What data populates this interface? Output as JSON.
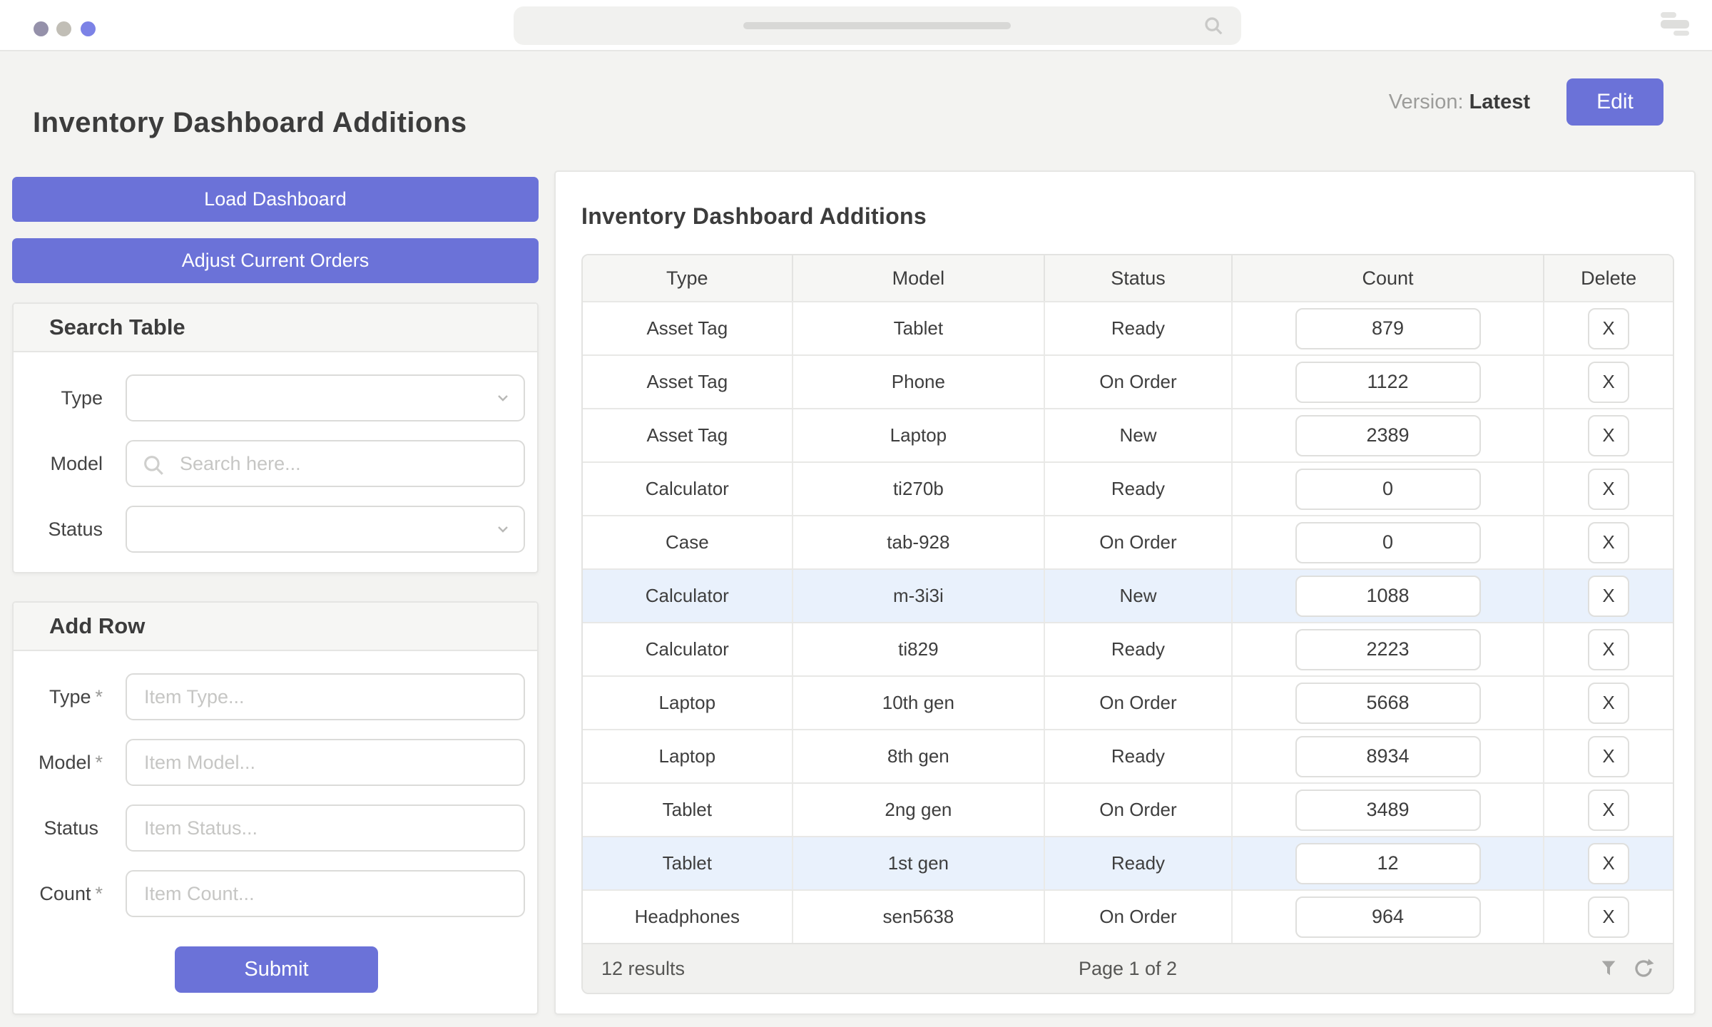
{
  "colors": {
    "accent": "#6b72d8",
    "row_highlight": "#e9f1fc",
    "window_dots": [
      "#9591aa",
      "#c1beb6",
      "#7c82e6"
    ]
  },
  "header": {
    "title": "Inventory Dashboard Additions",
    "version_label": "Version:",
    "version_value": "Latest",
    "edit_button": "Edit"
  },
  "sidebar": {
    "load_dashboard_button": "Load Dashboard",
    "adjust_orders_button": "Adjust Current Orders",
    "search_table": {
      "title": "Search Table",
      "fields": [
        {
          "label": "Type"
        },
        {
          "label": "Model",
          "placeholder": "Search here..."
        },
        {
          "label": "Status"
        }
      ]
    },
    "add_row": {
      "title": "Add Row",
      "fields": [
        {
          "label": "Type",
          "req_mark": "*",
          "placeholder": "Item Type..."
        },
        {
          "label": "Model",
          "req_mark": "*",
          "placeholder": "Item Model..."
        },
        {
          "label": "Status",
          "req_mark": "",
          "placeholder": "Item Status..."
        },
        {
          "label": "Count",
          "req_mark": "*",
          "placeholder": "Item Count..."
        }
      ],
      "submit_button": "Submit"
    }
  },
  "main": {
    "title": "Inventory Dashboard Additions",
    "table": {
      "columns": [
        "Type",
        "Model",
        "Status",
        "Count",
        "Delete"
      ],
      "delete_label": "X",
      "rows": [
        {
          "type": "Asset Tag",
          "model": "Tablet",
          "status": "Ready",
          "count": "879",
          "highlighted": false
        },
        {
          "type": "Asset Tag",
          "model": "Phone",
          "status": "On Order",
          "count": "1122",
          "highlighted": false
        },
        {
          "type": "Asset Tag",
          "model": "Laptop",
          "status": "New",
          "count": "2389",
          "highlighted": false
        },
        {
          "type": "Calculator",
          "model": "ti270b",
          "status": "Ready",
          "count": "0",
          "highlighted": false
        },
        {
          "type": "Case",
          "model": "tab-928",
          "status": "On Order",
          "count": "0",
          "highlighted": false
        },
        {
          "type": "Calculator",
          "model": "m-3i3i",
          "status": "New",
          "count": "1088",
          "highlighted": true
        },
        {
          "type": "Calculator",
          "model": "ti829",
          "status": "Ready",
          "count": "2223",
          "highlighted": false
        },
        {
          "type": "Laptop",
          "model": "10th gen",
          "status": "On Order",
          "count": "5668",
          "highlighted": false
        },
        {
          "type": "Laptop",
          "model": "8th gen",
          "status": "Ready",
          "count": "8934",
          "highlighted": false
        },
        {
          "type": "Tablet",
          "model": "2ng gen",
          "status": "On Order",
          "count": "3489",
          "highlighted": false
        },
        {
          "type": "Tablet",
          "model": "1st gen",
          "status": "Ready",
          "count": "12",
          "highlighted": true
        },
        {
          "type": "Headphones",
          "model": "sen5638",
          "status": "On Order",
          "count": "964",
          "highlighted": false
        }
      ],
      "footer": {
        "results": "12 results",
        "page": "Page 1 of 2"
      }
    }
  }
}
